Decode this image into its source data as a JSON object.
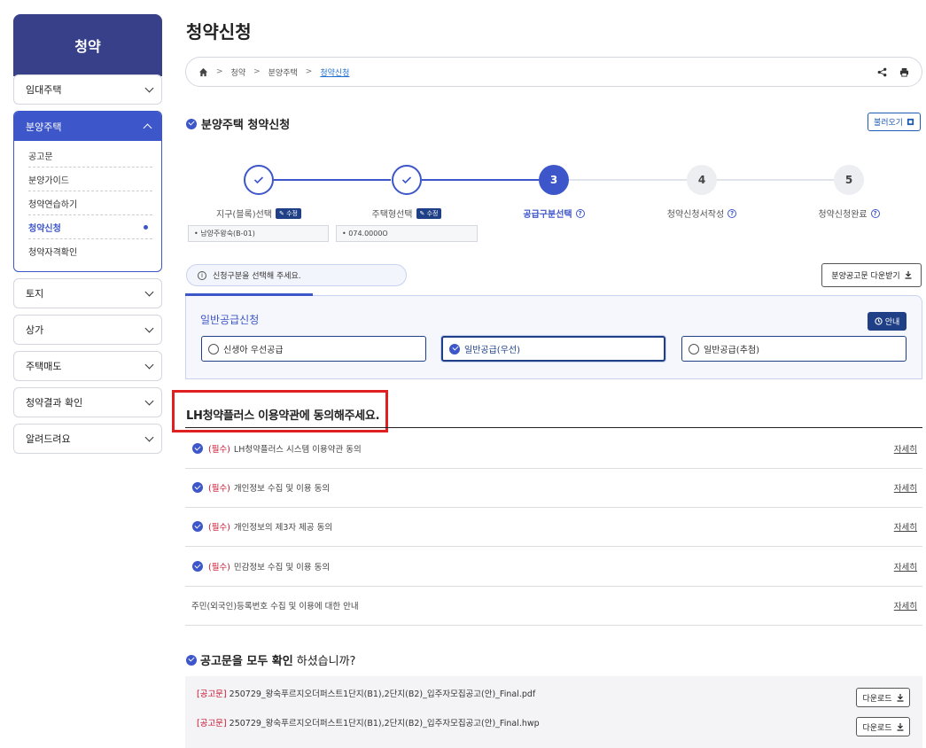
{
  "sidebar": {
    "title": "청약",
    "menus_top": [
      "임대주택"
    ],
    "open_menu": {
      "label": "분양주택",
      "items": [
        "공고문",
        "분양가이드",
        "청약연습하기",
        "청약신청",
        "청약자격확인"
      ],
      "active_index": 3
    },
    "menus_bottom": [
      "토지",
      "상가",
      "주택매도",
      "청약결과 확인",
      "알려드려요"
    ]
  },
  "page": {
    "title": "청약신청",
    "breadcrumb": [
      "청약",
      "분양주택",
      "청약신청"
    ]
  },
  "section": {
    "title": "분양주택 청약신청",
    "load_button": "불러오기"
  },
  "steps": {
    "items": [
      {
        "num": "1",
        "label": "지구(블록)선택",
        "state": "done",
        "edit": "수정",
        "value": "• 남양주왕숙(B-01)"
      },
      {
        "num": "2",
        "label": "주택형선택",
        "state": "done",
        "edit": "수정",
        "value": "• 074.0000O"
      },
      {
        "num": "3",
        "label": "공급구분선택",
        "state": "current"
      },
      {
        "num": "4",
        "label": "청약신청서작성",
        "state": "todo"
      },
      {
        "num": "5",
        "label": "청약신청완료",
        "state": "todo"
      }
    ]
  },
  "notice": {
    "text": "신청구분을 선택해 주세요.",
    "download_button": "분양공고문 다운받기"
  },
  "supply": {
    "title": "일반공급신청",
    "guide_button": "안내",
    "options": [
      "신생아 우선공급",
      "일반공급(우선)",
      "일반공급(추첨)"
    ],
    "selected_index": 1
  },
  "agreement": {
    "title": "LH청약플러스 이용약관에 동의해주세요.",
    "required_tag": "(필수)",
    "detail_link": "자세히",
    "items": [
      {
        "required": true,
        "text": "LH청약플러스 시스템 이용약관 동의"
      },
      {
        "required": true,
        "text": "개인정보 수집 및 이용 동의"
      },
      {
        "required": true,
        "text": "개인정보의 제3자 제공 동의"
      },
      {
        "required": true,
        "text": "민감정보 수집 및 이용 동의"
      },
      {
        "required": false,
        "text": "주민(외국인)등록번호 수집 및 이용에 대한 안내"
      }
    ]
  },
  "announcement": {
    "question_bold": "공고문을 모두 확인",
    "question_rest": "하셨습니까?",
    "tag": "[공고문]",
    "download_button": "다운로드",
    "files": [
      "250729_왕숙푸르지오더퍼스트1단지(B1),2단지(B2)_입주자모집공고(안)_Final.pdf",
      "250729_왕숙푸르지오더퍼스트1단지(B1),2단지(B2)_입주자모집공고(안)_Final.hwp"
    ]
  },
  "colors": {
    "primary": "#3d56c9",
    "navy": "#1f3f86",
    "sidebar_head": "#374088",
    "required": "#c8102e",
    "highlight": "#e02020"
  }
}
